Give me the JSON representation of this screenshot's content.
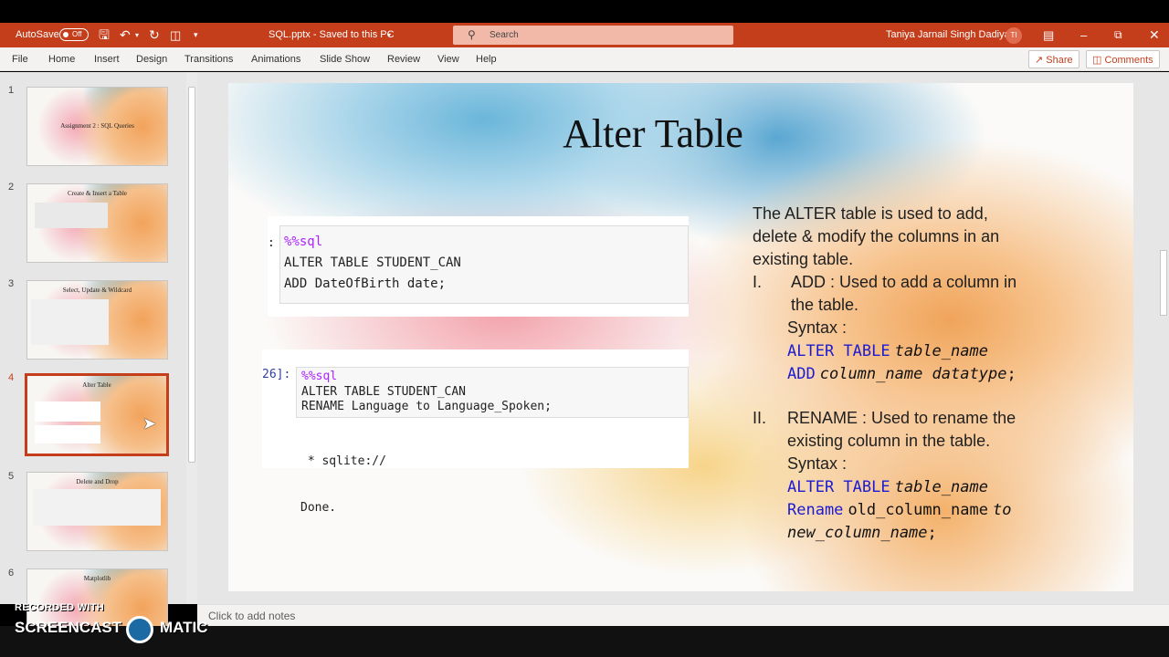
{
  "titlebar": {
    "autosave_label": "AutoSave",
    "autosave_state": "Off",
    "doc_title": "SQL.pptx  -  Saved to this PC",
    "search_placeholder": "Search",
    "user_name": "Taniya Jarnail Singh Dadiyal",
    "user_initials": "TI"
  },
  "ribbon": {
    "tabs": [
      "File",
      "Home",
      "Insert",
      "Design",
      "Transitions",
      "Animations",
      "Slide Show",
      "Review",
      "View",
      "Help"
    ],
    "share_label": "Share",
    "comments_label": "Comments"
  },
  "thumbnails": [
    {
      "num": "1",
      "title": "Assignment 2 : SQL Queries"
    },
    {
      "num": "2",
      "title": "Create & Insert a Table"
    },
    {
      "num": "3",
      "title": "Select, Update & Wildcard"
    },
    {
      "num": "4",
      "title": "Alter Table",
      "selected": true
    },
    {
      "num": "5",
      "title": "Delete and Drop"
    },
    {
      "num": "6",
      "title": "Matplotlib"
    }
  ],
  "slide": {
    "title": "Alter Table",
    "cell1": {
      "prompt": ":",
      "magic": "%%sql",
      "lines": [
        "ALTER TABLE STUDENT_CAN",
        "ADD DateOfBirth date;"
      ]
    },
    "cell2": {
      "prompt": "26]:",
      "magic": "%%sql",
      "lines": [
        "ALTER TABLE STUDENT_CAN",
        "RENAME Language to Language_Spoken;"
      ],
      "output": [
        " * sqlite://",
        "Done."
      ]
    },
    "body": {
      "intro": [
        "The ALTER table is used to add,",
        "delete & modify the columns in an",
        "existing table."
      ],
      "item1_num": "I.",
      "item1": [
        "ADD : Used to add a column in",
        "the table."
      ],
      "syntax_label": "Syntax :",
      "syn1_l1_kw": "ALTER TABLE",
      "syn1_l1_it": "table_name",
      "syn1_l2_kw": "ADD",
      "syn1_l2_it": "column_name datatype",
      "semicolon": ";",
      "item2_num": "II.",
      "item2": [
        "RENAME : Used to rename the",
        "existing column in the table."
      ],
      "syn2_l1_kw": "ALTER TABLE",
      "syn2_l1_it": "table_name",
      "syn2_l2_kw": "Rename",
      "syn2_l2_plain": "old_column_name",
      "syn2_l2_it": "to",
      "syn2_l3_it": "new_column_name"
    }
  },
  "notes_placeholder": "Click to add notes",
  "watermark": {
    "line1": "RECORDED WITH",
    "line2": "SCREENCAST",
    "line3": "MATIC"
  }
}
